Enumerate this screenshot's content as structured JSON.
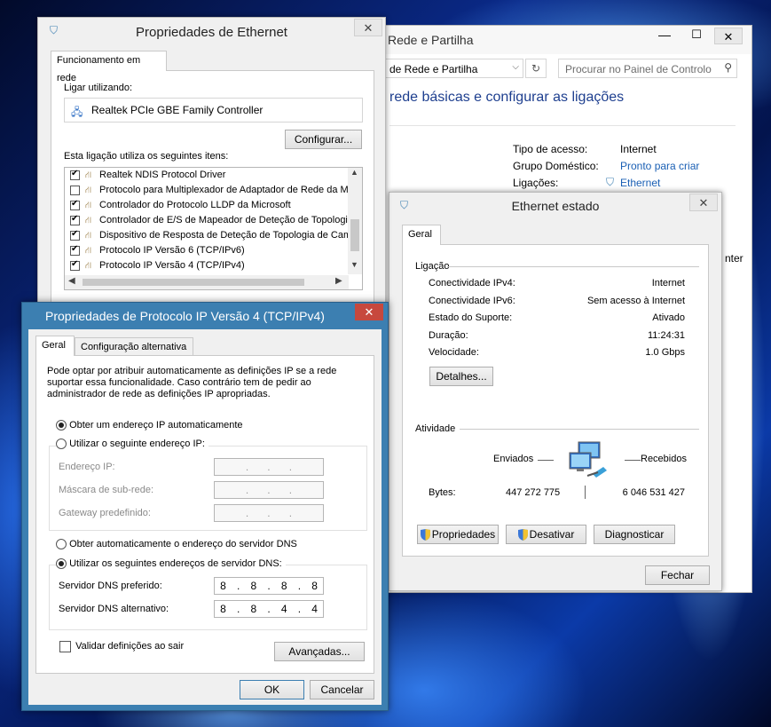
{
  "network_center": {
    "title": "Rede e Partilha",
    "address": "de Rede e Partilha",
    "search_placeholder": "Procurar no Painel de Controlo",
    "heading": "rede básicas e configurar as ligações",
    "access_type_label": "Tipo de acesso:",
    "access_type_value": "Internet",
    "homegroup_label": "Grupo Doméstico:",
    "homegroup_value": "Pronto para criar",
    "connections_label": "Ligações:",
    "connections_value": "Ethernet",
    "partial_text": "nter"
  },
  "eth_props": {
    "title": "Propriedades de Ethernet",
    "tab": "Funcionamento em rede",
    "connect_using_label": "Ligar utilizando:",
    "adapter": "Realtek PCIe GBE Family Controller",
    "configure_button": "Configurar...",
    "items_label": "Esta ligação utiliza os seguintes itens:",
    "items": [
      {
        "label": "Realtek NDIS Protocol Driver",
        "checked": true
      },
      {
        "label": "Protocolo para Multiplexador de Adaptador de Rede da Microsoft",
        "checked": false
      },
      {
        "label": "Controlador do Protocolo LLDP da Microsoft",
        "checked": true
      },
      {
        "label": "Controlador de E/S de Mapeador de Deteção de Topologia",
        "checked": true
      },
      {
        "label": "Dispositivo de Resposta de Deteção de Topologia de Camada",
        "checked": true
      },
      {
        "label": "Protocolo IP Versão 6 (TCP/IPv6)",
        "checked": true
      },
      {
        "label": "Protocolo IP Versão 4 (TCP/IPv4)",
        "checked": true
      }
    ]
  },
  "eth_status": {
    "title": "Ethernet estado",
    "tab": "Geral",
    "connection_label": "Ligação",
    "ipv4_label": "Conectividade IPv4:",
    "ipv4_value": "Internet",
    "ipv6_label": "Conectividade IPv6:",
    "ipv6_value": "Sem acesso à Internet",
    "media_label": "Estado do Suporte:",
    "media_value": "Ativado",
    "duration_label": "Duração:",
    "duration_value": "11:24:31",
    "speed_label": "Velocidade:",
    "speed_value": "1.0 Gbps",
    "details_button": "Detalhes...",
    "activity_label": "Atividade",
    "sent_label": "Enviados",
    "received_label": "Recebidos",
    "bytes_label": "Bytes:",
    "bytes_sent": "447 272 775",
    "bytes_received": "6 046 531 427",
    "properties_button": "Propriedades",
    "disable_button": "Desativar",
    "diagnose_button": "Diagnosticar",
    "close_button": "Fechar"
  },
  "ipv4_props": {
    "title": "Propriedades de Protocolo IP Versão 4 (TCP/IPv4)",
    "tab_general": "Geral",
    "tab_alternate": "Configuração alternativa",
    "description": "Pode optar por atribuir automaticamente as definições IP se a rede suportar essa funcionalidade. Caso contrário tem de pedir ao administrador de rede as definições IP apropriadas.",
    "obtain_ip_auto": "Obter um endereço IP automaticamente",
    "use_ip": "Utilizar o seguinte endereço IP:",
    "ip_address_label": "Endereço IP:",
    "subnet_label": "Máscara de sub-rede:",
    "gateway_label": "Gateway predefinido:",
    "obtain_dns_auto": "Obter automaticamente o endereço do servidor DNS",
    "use_dns": "Utilizar os seguintes endereços de servidor DNS:",
    "preferred_dns_label": "Servidor DNS preferido:",
    "preferred_dns": [
      "8",
      "8",
      "8",
      "8"
    ],
    "alternate_dns_label": "Servidor DNS alternativo:",
    "alternate_dns": [
      "8",
      "8",
      "4",
      "4"
    ],
    "validate_label": "Validar definições ao sair",
    "advanced_button": "Avançadas...",
    "ok_button": "OK",
    "cancel_button": "Cancelar"
  },
  "colors": {
    "accent_blue": "#3c7fb1",
    "close_red": "#c7483d",
    "link_blue": "#1a5fb4"
  }
}
